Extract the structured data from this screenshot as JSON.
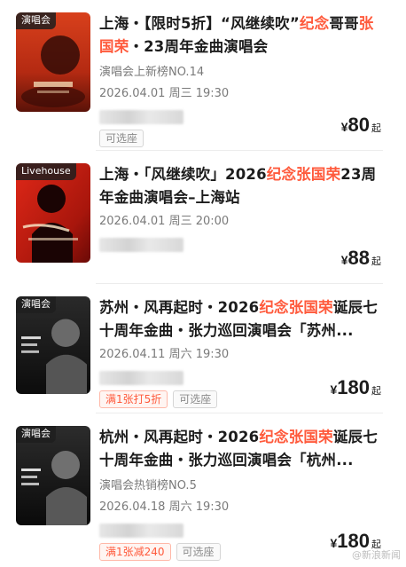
{
  "events": [
    {
      "poster_tag": "演唱会",
      "title_parts": [
        "上海・【限时5折】“风继续吹”",
        "纪念",
        "哥哥",
        "张国荣",
        "・23周年金曲演唱会"
      ],
      "subtitle": "演唱会上新榜NO.14",
      "datetime": "2026.04.01 周三 19:30",
      "tags": [
        "可选座"
      ],
      "price": {
        "currency": "¥",
        "value": "80",
        "suffix": "起"
      }
    },
    {
      "poster_tag": "Livehouse",
      "title_parts": [
        "上海・「风继续吹」2026",
        "纪念张国荣",
        "23周年金曲演唱会–上海站"
      ],
      "datetime": "2026.04.01 周三 20:00",
      "price": {
        "currency": "¥",
        "value": "88",
        "suffix": "起"
      }
    },
    {
      "poster_tag": "演唱会",
      "title_parts": [
        "苏州・风再起时・2026",
        "纪念张国荣",
        "诞辰七十周年金曲・张力巡回演唱会「苏州..."
      ],
      "datetime": "2026.04.11 周六 19:30",
      "tags": [
        "满1张打5折",
        "可选座"
      ],
      "price": {
        "currency": "¥",
        "value": "180",
        "suffix": "起"
      }
    },
    {
      "poster_tag": "演唱会",
      "title_parts": [
        "杭州・风再起时・2026",
        "纪念张国荣",
        "诞辰七十周年金曲・张力巡回演唱会「杭州..."
      ],
      "subtitle": "演唱会热销榜NO.5",
      "datetime": "2026.04.18 周六 19:30",
      "tags": [
        "满1张减240",
        "可选座"
      ],
      "price": {
        "currency": "¥",
        "value": "180",
        "suffix": "起"
      }
    }
  ],
  "watermark": "@新浪新闻",
  "colors": {
    "accent": "#ff5a3c",
    "text": "#1c1c1c",
    "muted": "#7a7a7a"
  }
}
